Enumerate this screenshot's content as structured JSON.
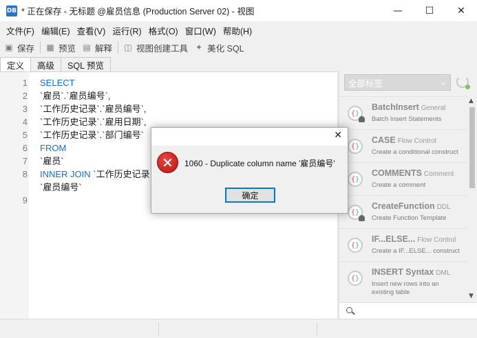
{
  "window": {
    "title": "* 正在保存 - 无标题 @雇员信息 (Production Server 02) - 视图",
    "app_icon_text": "DB"
  },
  "menu": {
    "items": [
      "文件(F)",
      "编辑(E)",
      "查看(V)",
      "运行(R)",
      "格式(O)",
      "窗口(W)",
      "帮助(H)"
    ]
  },
  "toolbar": {
    "save": "保存",
    "preview": "预览",
    "explain": "解释",
    "view_builder": "视图创建工具",
    "beautify": "美化 SQL"
  },
  "tabs": [
    "定义",
    "高级",
    "SQL 预览"
  ],
  "editor": {
    "line_numbers": [
      "1",
      "2",
      "3",
      "4",
      "5",
      "6",
      "7",
      "8",
      "",
      "9"
    ],
    "lines": [
      {
        "kw": "SELECT",
        "text": ""
      },
      {
        "kw": "",
        "text": "`雇员`.`雇员编号`,"
      },
      {
        "kw": "",
        "text": "`工作历史记录`.`雇员编号`,"
      },
      {
        "kw": "",
        "text": "`工作历史记录`.`雇用日期`,"
      },
      {
        "kw": "",
        "text": "`工作历史记录`.`部门编号`"
      },
      {
        "kw": "FROM",
        "text": ""
      },
      {
        "kw": "",
        "text": "`雇员`"
      },
      {
        "kw": "INNER JOIN",
        "text": " `工作历史记录"
      },
      {
        "kw": "",
        "text": "`雇员编号`"
      },
      {
        "kw": "",
        "text": ""
      }
    ]
  },
  "right_panel": {
    "tag_filter": "全部标签",
    "snippets": [
      {
        "name": "BatchInsert",
        "category": "General",
        "desc": "Batch Insert Statements"
      },
      {
        "name": "CASE",
        "category": "Flow Control",
        "desc": "Create a conditional construct"
      },
      {
        "name": "COMMENTS",
        "category": "Comment",
        "desc": "Create a comment"
      },
      {
        "name": "CreateFunction",
        "category": "DDL",
        "desc": "Create Function Template"
      },
      {
        "name": "IF...ELSE...",
        "category": "Flow Control",
        "desc": "Create a IF...ELSE... construct"
      },
      {
        "name": "INSERT Syntax",
        "category": "DML",
        "desc": "Insert new rows into an existing table"
      }
    ]
  },
  "dialog": {
    "message": "1060 - Duplicate column name '雇员编号'",
    "ok": "确定"
  }
}
